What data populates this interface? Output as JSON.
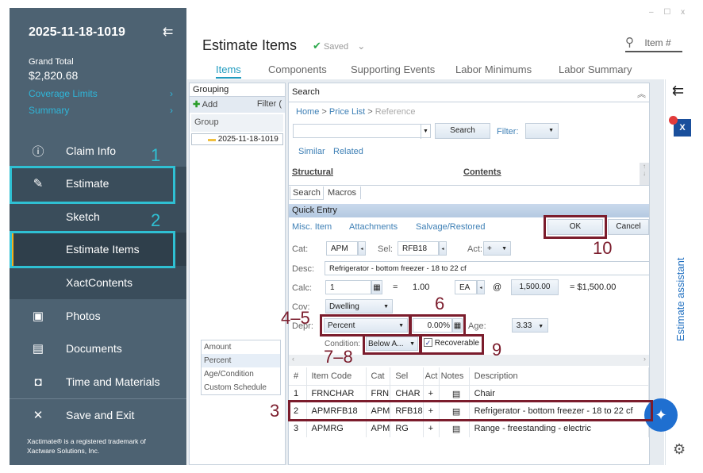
{
  "window": {
    "minimize": "–",
    "maximize": "☐",
    "close": "x"
  },
  "sidebar": {
    "claim_id": "2025-11-18-1019",
    "grand_total_label": "Grand Total",
    "grand_total": "$2,820.68",
    "links": [
      {
        "label": "Coverage Limits"
      },
      {
        "label": "Summary"
      }
    ],
    "items": [
      {
        "label": "Claim Info",
        "icon": "info-icon"
      },
      {
        "label": "Estimate",
        "icon": "pencil-icon"
      },
      {
        "label": "Sketch"
      },
      {
        "label": "Estimate Items"
      },
      {
        "label": "XactContents"
      },
      {
        "label": "Photos",
        "icon": "photos-icon"
      },
      {
        "label": "Documents",
        "icon": "documents-icon"
      },
      {
        "label": "Time and Materials",
        "icon": "briefcase-icon"
      },
      {
        "label": "Save and Exit",
        "icon": "close-icon"
      }
    ],
    "footer": "Xactimate® is a registered trademark of Xactware Solutions, Inc."
  },
  "header": {
    "title": "Estimate Items",
    "status": "Saved",
    "search_placeholder": "Item #"
  },
  "tabs": [
    {
      "label": "Items",
      "active": true
    },
    {
      "label": "Components"
    },
    {
      "label": "Supporting Events"
    },
    {
      "label": "Labor Minimums"
    },
    {
      "label": "Labor Summary"
    }
  ],
  "grouping": {
    "title": "Grouping",
    "add": "Add",
    "filter": "Filter (",
    "column": "Group",
    "items": [
      "2025-11-18-1019"
    ],
    "depr_options": [
      "Amount",
      "Percent",
      "Age/Condition",
      "Custom Schedule"
    ],
    "depr_selected": "Percent"
  },
  "search": {
    "title": "Search",
    "breadcrumb": [
      "Home",
      "Price List",
      "Reference"
    ],
    "search_button": "Search",
    "filter_label": "Filter:",
    "links": [
      "Similar",
      "Related"
    ],
    "categories": [
      "Structural",
      "Contents"
    ],
    "tabs": [
      "Search",
      "Macros"
    ]
  },
  "quick_entry": {
    "title": "Quick Entry",
    "links": [
      "Misc. Item",
      "Attachments",
      "Salvage/Restored"
    ],
    "ok": "OK",
    "cancel": "Cancel",
    "cat_label": "Cat:",
    "cat": "APM",
    "sel_label": "Sel:",
    "sel": "RFB18",
    "act_label": "Act:",
    "act": "+",
    "desc_label": "Desc:",
    "desc": "Refrigerator - bottom freezer - 18 to 22 cf",
    "calc_label": "Calc:",
    "calc": "1",
    "eq1": "=",
    "qty": "1.00",
    "unit": "EA",
    "at": "@",
    "price": "1,500.00",
    "total": "= $1,500.00",
    "cov_label": "Cov:",
    "cov": "Dwelling",
    "depr_label": "Depr:",
    "depr_type": "Percent",
    "depr_value": "0.00%",
    "age_label": "Age:",
    "age": "3.33",
    "condition_label": "Condition:",
    "condition": "Below A...",
    "recoverable_label": "Recoverable",
    "recoverable": true
  },
  "table": {
    "columns": [
      "#",
      "Item Code",
      "Cat",
      "Sel",
      "Act",
      "Notes",
      "Description"
    ],
    "rows": [
      [
        "1",
        "FRNCHAR",
        "FRN",
        "CHAR",
        "+",
        "",
        "Chair"
      ],
      [
        "2",
        "APMRFB18",
        "APM",
        "RFB18",
        "+",
        "",
        "Refrigerator - bottom freezer - 18 to 22 cf"
      ],
      [
        "3",
        "APMRG",
        "APM",
        "RG",
        "+",
        "",
        "Range - freestanding - electric"
      ]
    ]
  },
  "assistant": {
    "label": "Estimate assistant"
  },
  "annotations": [
    "1",
    "2",
    "3",
    "4–5",
    "6",
    "7–8",
    "9",
    "10"
  ],
  "colors": {
    "sidebar": "#4d6272",
    "accent": "#2fb6d9",
    "annotation_red": "#7b1c2c",
    "annotation_cyan": "#2fc0d3"
  }
}
